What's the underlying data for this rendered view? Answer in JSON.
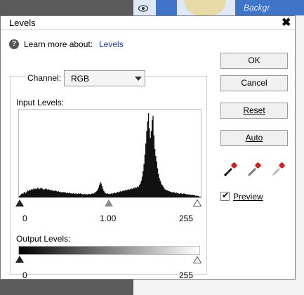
{
  "background": {
    "layer_name": "Backgr"
  },
  "dialog": {
    "title": "Levels",
    "close_glyph": "✖",
    "help": {
      "icon": "?",
      "text": "Learn more about:",
      "link": "Levels"
    },
    "channel": {
      "label": "Channel:",
      "value": "RGB"
    },
    "input_levels": {
      "label": "Input Levels:",
      "black": "0",
      "gray": "1.00",
      "white": "255"
    },
    "output_levels": {
      "label": "Output Levels:",
      "black": "0",
      "white": "255"
    },
    "buttons": {
      "ok": "OK",
      "cancel": "Cancel",
      "reset": "Reset",
      "auto": "Auto"
    },
    "preview": {
      "label": "Preview",
      "checked": true
    }
  },
  "histogram": [
    2,
    3,
    5,
    6,
    5,
    7,
    8,
    6,
    8,
    10,
    9,
    11,
    10,
    12,
    11,
    12,
    13,
    12,
    13,
    12,
    14,
    13,
    12,
    13,
    14,
    13,
    12,
    11,
    12,
    13,
    12,
    11,
    12,
    11,
    10,
    11,
    10,
    9,
    10,
    9,
    10,
    9,
    8,
    9,
    8,
    8,
    7,
    8,
    7,
    8,
    7,
    7,
    6,
    7,
    6,
    7,
    6,
    6,
    5,
    6,
    6,
    5,
    6,
    5,
    5,
    6,
    5,
    6,
    5,
    5,
    4,
    5,
    5,
    4,
    5,
    4,
    5,
    5,
    4,
    5,
    6,
    5,
    6,
    7,
    8,
    9,
    11,
    14,
    18,
    22,
    20,
    16,
    12,
    9,
    7,
    6,
    5,
    6,
    5,
    5,
    5,
    6,
    5,
    6,
    6,
    7,
    6,
    7,
    8,
    7,
    8,
    9,
    8,
    9,
    10,
    9,
    10,
    11,
    10,
    11,
    12,
    11,
    12,
    13,
    12,
    13,
    14,
    13,
    15,
    14,
    16,
    15,
    18,
    20,
    24,
    30,
    38,
    48,
    62,
    78,
    96,
    110,
    122,
    100,
    86,
    96,
    112,
    118,
    90,
    70,
    60,
    52,
    42,
    34,
    28,
    24,
    20,
    18,
    16,
    14,
    12,
    11,
    10,
    10,
    9,
    9,
    8,
    8,
    7,
    8,
    7,
    7,
    6,
    7,
    6,
    6,
    5,
    6,
    6,
    5,
    5,
    6,
    5,
    5,
    4,
    5,
    4,
    4,
    4,
    3,
    4,
    3,
    3,
    3,
    2,
    3,
    2,
    2,
    1,
    1
  ]
}
